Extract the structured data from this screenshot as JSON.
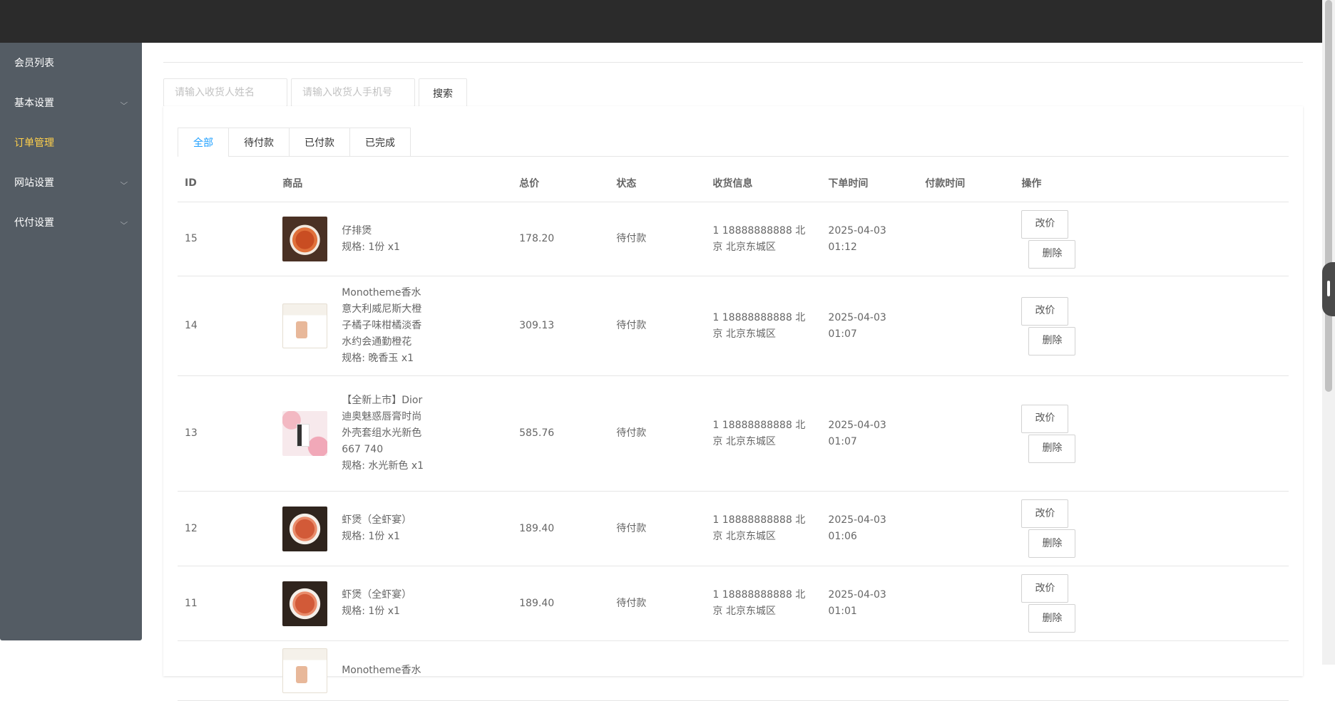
{
  "sidebar": {
    "items": [
      {
        "label": "会员列表",
        "expandable": false,
        "active": false
      },
      {
        "label": "基本设置",
        "expandable": true,
        "active": false
      },
      {
        "label": "订单管理",
        "expandable": false,
        "active": true
      },
      {
        "label": "网站设置",
        "expandable": true,
        "active": false
      },
      {
        "label": "代付设置",
        "expandable": true,
        "active": false
      }
    ]
  },
  "search": {
    "name_placeholder": "请输入收货人姓名",
    "phone_placeholder": "请输入收货人手机号",
    "button_label": "搜索"
  },
  "tabs": [
    "全部",
    "待付款",
    "已付款",
    "已完成"
  ],
  "table": {
    "headers": [
      "ID",
      "商品",
      "总价",
      "状态",
      "收货信息",
      "下单时间",
      "付款时间",
      "操作"
    ],
    "rows": [
      {
        "id": "15",
        "goods_name": "仔排煲",
        "spec": "规格: 1份 x1",
        "total": "178.20",
        "status": "待付款",
        "receiver": "1 18888888888 北京 北京东城区",
        "order_time": "2025-04-03 01:12",
        "pay_time": "",
        "edit_label": "改价",
        "delete_label": "删除"
      },
      {
        "id": "14",
        "goods_name": "Monotheme香水 意大利威尼斯大橙 子橘子味柑橘淡香 水约会通勤橙花",
        "spec": "规格: 晚香玉 x1",
        "total": "309.13",
        "status": "待付款",
        "receiver": "1 18888888888 北京 北京东城区",
        "order_time": "2025-04-03 01:07",
        "pay_time": "",
        "edit_label": "改价",
        "delete_label": "删除"
      },
      {
        "id": "13",
        "goods_name": "【全新上市】Dior 迪奥魅惑唇膏时尚 外壳套组水光新色 667 740",
        "spec": "规格: 水光新色 x1",
        "total": "585.76",
        "status": "待付款",
        "receiver": "1 18888888888 北京 北京东城区",
        "order_time": "2025-04-03 01:07",
        "pay_time": "",
        "edit_label": "改价",
        "delete_label": "删除"
      },
      {
        "id": "12",
        "goods_name": "虾煲（全虾宴）",
        "spec": "规格: 1份 x1",
        "total": "189.40",
        "status": "待付款",
        "receiver": "1 18888888888 北京 北京东城区",
        "order_time": "2025-04-03 01:06",
        "pay_time": "",
        "edit_label": "改价",
        "delete_label": "删除"
      },
      {
        "id": "11",
        "goods_name": "虾煲（全虾宴）",
        "spec": "规格: 1份 x1",
        "total": "189.40",
        "status": "待付款",
        "receiver": "1 18888888888 北京 北京东城区",
        "order_time": "2025-04-03 01:01",
        "pay_time": "",
        "edit_label": "改价",
        "delete_label": "删除"
      },
      {
        "id": "",
        "goods_name": "Monotheme香水",
        "spec": "",
        "total": "",
        "status": "",
        "receiver": "",
        "order_time": "",
        "pay_time": "",
        "edit_label": "",
        "delete_label": ""
      }
    ]
  },
  "colors": {
    "topbar": "#2b2b2b",
    "sidebar": "#545c64",
    "sidebar_active": "#ffd04b",
    "tab_active": "#1e9fff"
  }
}
